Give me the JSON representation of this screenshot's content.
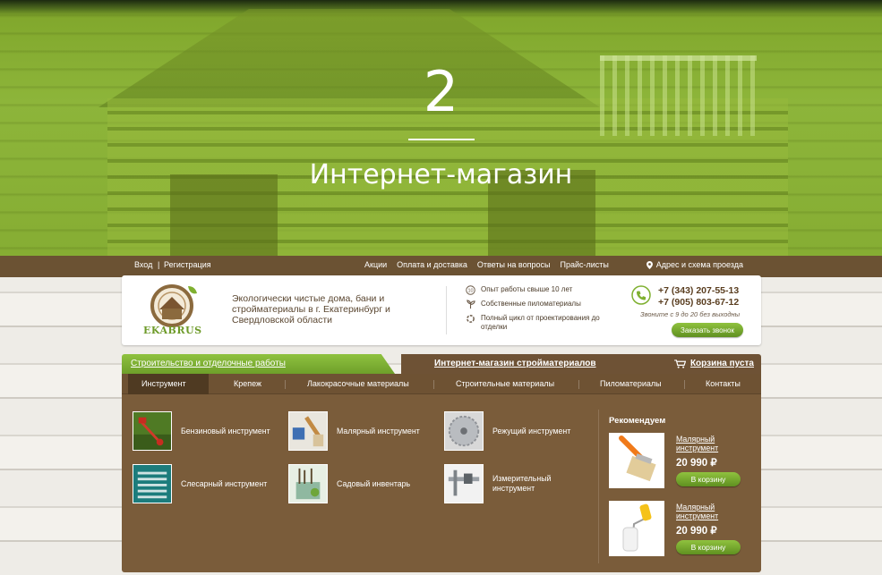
{
  "hero": {
    "number": "2",
    "title": "Интернет-магазин"
  },
  "topbar": {
    "login": "Вход",
    "separator": "|",
    "register": "Регистрация",
    "nav": [
      "Акции",
      "Оплата и доставка",
      "Ответы на вопросы",
      "Прайс-листы"
    ],
    "address": "Адрес и схема проезда"
  },
  "header": {
    "logo_text": "EKABRUS",
    "tagline": "Экологически чистые дома, бани и стройматериалы в г. Екатеринбург и Свердловской области",
    "features": [
      {
        "icon": "ten-badge-icon",
        "text": "Опыт работы свыше 10 лет"
      },
      {
        "icon": "sprout-icon",
        "text": "Собственные пиломатериалы"
      },
      {
        "icon": "cycle-icon",
        "text": "Полный цикл от проектирования до отделки"
      }
    ],
    "phone1": "+7 (343) 207-55-13",
    "phone2": "+7 (905) 803-67-12",
    "call_note": "Звоните с 9 до 20 без выходны",
    "callback_label": "Заказать звонок"
  },
  "tabs": {
    "construction": "Строительство и отделочные работы",
    "store": "Интернет-магазин стройматериалов",
    "cart": "Корзина пуста"
  },
  "catnav": [
    "Инструмент",
    "Крепеж",
    "Лакокрасочные материалы",
    "Строительные материалы",
    "Пиломатериалы",
    "Контакты"
  ],
  "categories": [
    {
      "label": "Бензиновый инструмент",
      "icon": "trimmer-icon"
    },
    {
      "label": "Малярный инструмент",
      "icon": "paint-brush-icon"
    },
    {
      "label": "Режущий инструмент",
      "icon": "saw-blade-icon"
    },
    {
      "label": "Слесарный инструмент",
      "icon": "toolset-icon"
    },
    {
      "label": "Садовый инвентарь",
      "icon": "garden-tools-icon"
    },
    {
      "label": "Измерительный инструмент",
      "icon": "caliper-icon"
    }
  ],
  "recommended": {
    "title": "Рекомендуем",
    "items": [
      {
        "name": "Малярный инструмент",
        "price": "20 990 ₽",
        "button": "В корзину",
        "icon": "brush-product-icon"
      },
      {
        "name": "Малярный инструмент",
        "price": "20 990 ₽",
        "button": "В корзину",
        "icon": "roller-product-icon"
      }
    ]
  },
  "colors": {
    "accent_green": "#7fb030",
    "panel_brown": "#7a5c3a",
    "dark_brown": "#6e5233"
  }
}
